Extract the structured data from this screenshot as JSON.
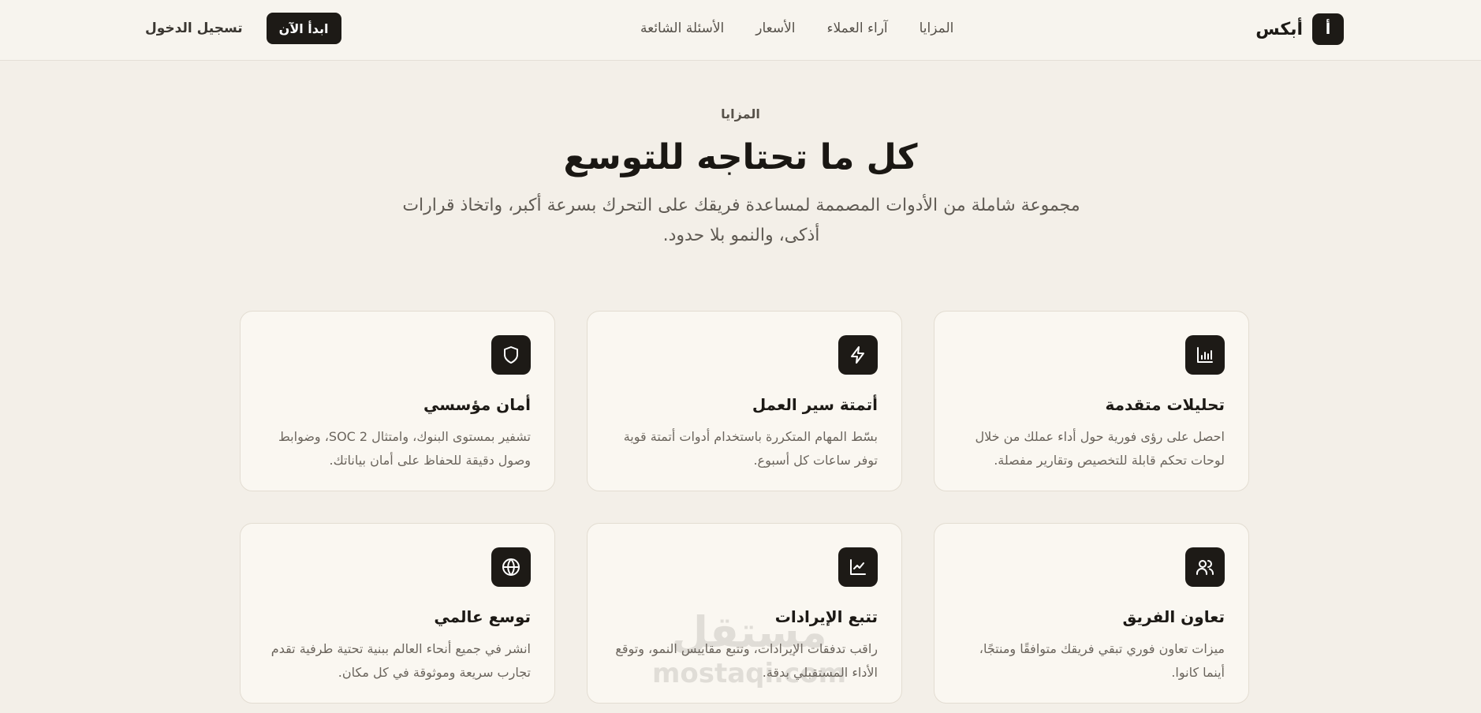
{
  "header": {
    "brand_mark": "أ",
    "brand_name": "أبكس",
    "nav": [
      "المزايا",
      "آراء العملاء",
      "الأسعار",
      "الأسئلة الشائعة"
    ],
    "login_label": "تسجيل الدخول",
    "cta_label": "ابدأ الآن"
  },
  "section": {
    "eyebrow": "المزايا",
    "title": "كل ما تحتاجه للتوسع",
    "subtitle": "مجموعة شاملة من الأدوات المصممة لمساعدة فريقك على التحرك بسرعة أكبر، واتخاذ قرارات أذكى، والنمو بلا حدود."
  },
  "features": [
    {
      "icon": "bar-chart-icon",
      "title": "تحليلات متقدمة",
      "desc": "احصل على رؤى فورية حول أداء عملك من خلال لوحات تحكم قابلة للتخصيص وتقارير مفصلة."
    },
    {
      "icon": "lightning-icon",
      "title": "أتمتة سير العمل",
      "desc": "بسّط المهام المتكررة باستخدام أدوات أتمتة قوية توفر ساعات كل أسبوع."
    },
    {
      "icon": "shield-icon",
      "title": "أمان مؤسسي",
      "desc": "تشفير بمستوى البنوك، وامتثال SOC 2، وضوابط وصول دقيقة للحفاظ على أمان بياناتك."
    },
    {
      "icon": "users-icon",
      "title": "تعاون الفريق",
      "desc": "ميزات تعاون فوري تبقي فريقك متوافقًا ومنتجًا، أينما كانوا."
    },
    {
      "icon": "trend-line-icon",
      "title": "تتبع الإيرادات",
      "desc": "راقب تدفقات الإيرادات، وتتبع مقاييس النمو، وتوقع الأداء المستقبلي بدقة."
    },
    {
      "icon": "globe-icon",
      "title": "توسع عالمي",
      "desc": "انشر في جميع أنحاء العالم ببنية تحتية طرفية تقدم تجارب سريعة وموثوقة في كل مكان."
    }
  ],
  "watermark": {
    "arabic": "مستقل",
    "latin": "mostaqi.com"
  }
}
